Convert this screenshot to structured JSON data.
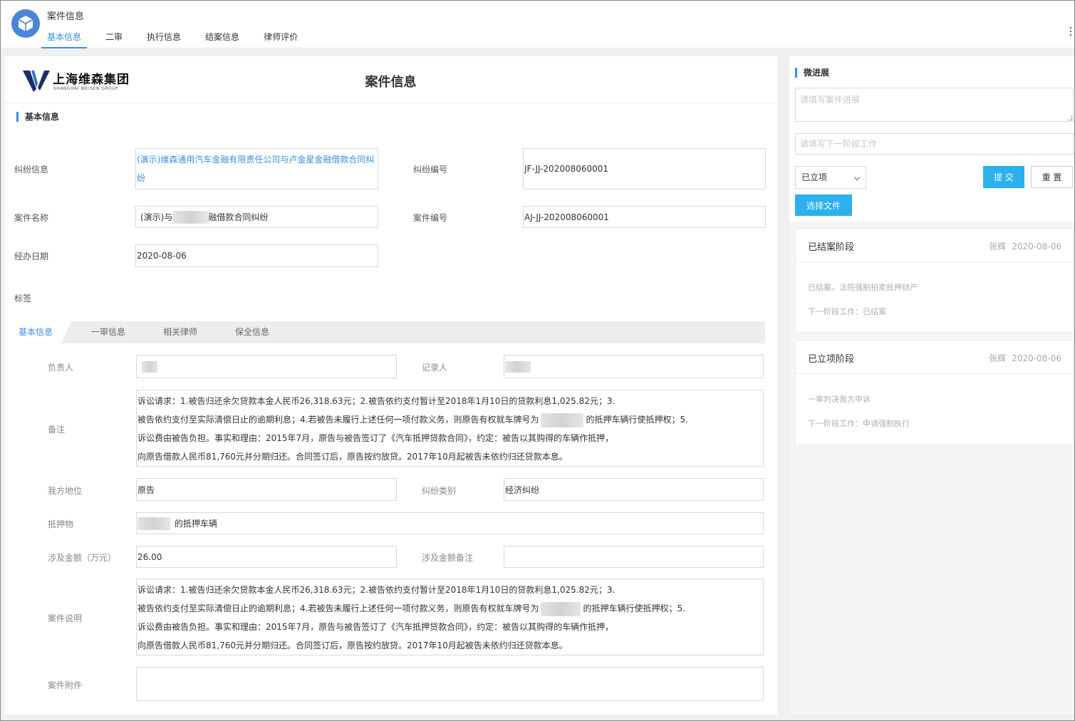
{
  "app": {
    "title": "案件信息",
    "tabs": [
      {
        "label": "基本信息",
        "active": true
      },
      {
        "label": "二审"
      },
      {
        "label": "执行信息"
      },
      {
        "label": "结案信息"
      },
      {
        "label": "律师评价"
      }
    ]
  },
  "doc": {
    "logo_text": "上海维森集团",
    "logo_sub": "SHANGHAI WEISEN GROUP",
    "title": "案件信息",
    "section_basic": "基本信息",
    "fields": {
      "dispute_label": "纠纷信息",
      "dispute_value": "(演示)维森通用汽车金融有限责任公司与卢金星金融借款合同纠纷",
      "dispute_no_label": "纠纷编号",
      "dispute_no_value": "JF-JJ-202008060001",
      "case_name_label": "案件名称",
      "case_name_pre": "(演示)与",
      "case_name_post": "融借款合同纠纷",
      "case_no_label": "案件编号",
      "case_no_value": "AJ-JJ-202008060001",
      "date_label": "经办日期",
      "date_value": "2020-08-06",
      "tag_label": "标签"
    },
    "subtabs": [
      {
        "label": "基本信息",
        "active": true
      },
      {
        "label": "一审信息"
      },
      {
        "label": "相关律师"
      },
      {
        "label": "保全信息"
      }
    ],
    "detail": {
      "owner_label": "负责人",
      "recorder_label": "记录人",
      "remark_label": "备注",
      "remark_lines": [
        "诉讼请求：1.被告归还余欠贷款本金人民币26,318.63元；2.被告依约支付暂计至2018年1月10日的贷款利息1,025.82元；3.",
        "被告依约支付至实际清偿日止的逾期利息；4.若被告未履行上述任何一项付款义务，则原告有权就车牌号为",
        "的抵押车辆行使抵押权；5.",
        "诉讼费由被告负担。事实和理由：2015年7月，原告与被告签订了《汽车抵押贷款合同》，约定：被告以其购得的车辆作抵押，",
        "向原告借款人民币81,760元并分期归还。合同签订后，原告按约放贷。2017年10月起被告未依约归还贷款本息。"
      ],
      "position_label": "我方地位",
      "position_value": "原告",
      "category_label": "纠纷类别",
      "category_value": "经济纠纷",
      "collateral_label": "抵押物",
      "collateral_value": "的抵押车辆",
      "amount_label": "涉及金额（万元）",
      "amount_value": "26.00",
      "amount_note_label": "涉及金额备注",
      "desc_label": "案件说明",
      "attachment_label": "案件附件"
    }
  },
  "side": {
    "section": "微进展",
    "progress_placeholder": "请填写案件进展",
    "next_placeholder": "请填写下一阶段工作",
    "stage_select": "已立项",
    "submit_label": "提 交",
    "reset_label": "重 置",
    "file_label": "选择文件",
    "cards": [
      {
        "title": "已结案阶段",
        "user": "张辉",
        "date": "2020-08-06",
        "line1": "已结案，法院强制拍卖抵押财产",
        "line2": "下一阶段工作：已结案"
      },
      {
        "title": "已立项阶段",
        "user": "张辉",
        "date": "2020-08-06",
        "line1": "一审判决我方申诉",
        "line2": "下一阶段工作：申请强制执行"
      }
    ]
  },
  "colors": {
    "accent": "#3a8ee6",
    "primary_button": "#2bb1ee"
  }
}
